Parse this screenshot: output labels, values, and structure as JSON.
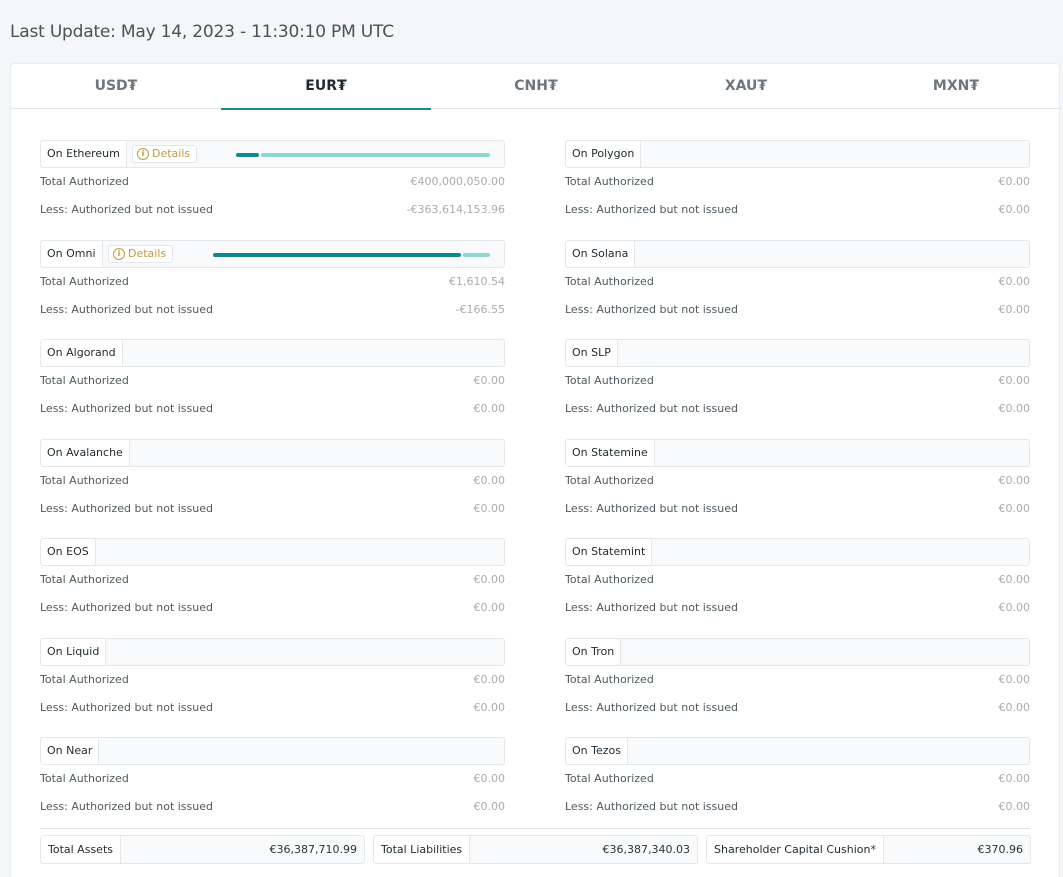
{
  "last_update": "Last Update: May 14, 2023 - 11:30:10 PM UTC",
  "tabs": [
    {
      "label": "USD₮",
      "active": false
    },
    {
      "label": "EUR₮",
      "active": true
    },
    {
      "label": "CNH₮",
      "active": false
    },
    {
      "label": "XAU₮",
      "active": false
    },
    {
      "label": "MXN₮",
      "active": false
    }
  ],
  "row_labels": {
    "total_authorized": "Total Authorized",
    "not_issued": "Less: Authorized but not issued"
  },
  "details_label": "Details",
  "colors": {
    "accent": "#1b8a8f",
    "bar_issued": "#13888e",
    "bar_unissued": "#8dd8d0",
    "details": "#c49a3c"
  },
  "chains_left": [
    {
      "name": "On Ethereum",
      "total_authorized": "€400,000,050.00",
      "not_issued": "-€363,614,153.96",
      "has_details": true,
      "issued_fraction": 0.091
    },
    {
      "name": "On Omni",
      "total_authorized": "€1,610.54",
      "not_issued": "-€166.55",
      "has_details": true,
      "issued_fraction": 0.897
    },
    {
      "name": "On Algorand",
      "total_authorized": "€0.00",
      "not_issued": "€0.00"
    },
    {
      "name": "On Avalanche",
      "total_authorized": "€0.00",
      "not_issued": "€0.00"
    },
    {
      "name": "On EOS",
      "total_authorized": "€0.00",
      "not_issued": "€0.00"
    },
    {
      "name": "On Liquid",
      "total_authorized": "€0.00",
      "not_issued": "€0.00"
    },
    {
      "name": "On Near",
      "total_authorized": "€0.00",
      "not_issued": "€0.00"
    }
  ],
  "chains_right": [
    {
      "name": "On Polygon",
      "total_authorized": "€0.00",
      "not_issued": "€0.00"
    },
    {
      "name": "On Solana",
      "total_authorized": "€0.00",
      "not_issued": "€0.00"
    },
    {
      "name": "On SLP",
      "total_authorized": "€0.00",
      "not_issued": "€0.00"
    },
    {
      "name": "On Statemine",
      "total_authorized": "€0.00",
      "not_issued": "€0.00"
    },
    {
      "name": "On Statemint",
      "total_authorized": "€0.00",
      "not_issued": "€0.00"
    },
    {
      "name": "On Tron",
      "total_authorized": "€0.00",
      "not_issued": "€0.00"
    },
    {
      "name": "On Tezos",
      "total_authorized": "€0.00",
      "not_issued": "€0.00"
    }
  ],
  "totals": {
    "assets_label": "Total Assets",
    "assets_value": "€36,387,710.99",
    "liabilities_label": "Total Liabilities",
    "liabilities_value": "€36,387,340.03",
    "cushion_label": "Shareholder Capital Cushion*",
    "cushion_value": "€370.96"
  }
}
